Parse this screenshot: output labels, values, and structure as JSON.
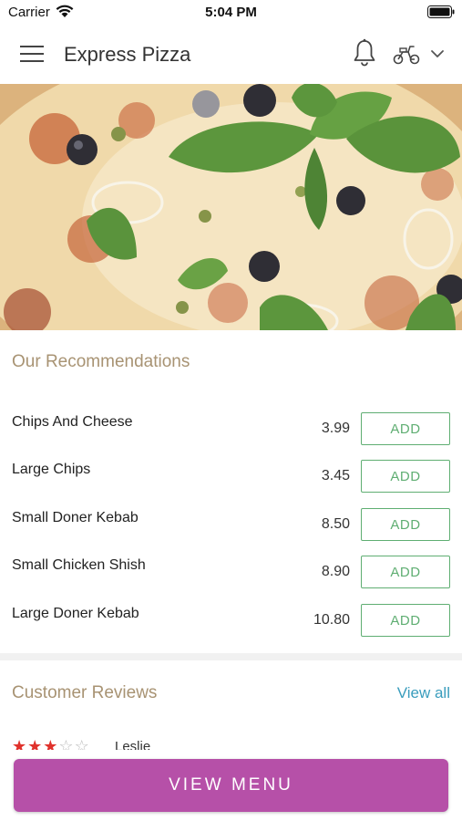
{
  "status_bar": {
    "carrier": "Carrier",
    "time": "5:04 PM"
  },
  "header": {
    "title": "Express Pizza",
    "icons": [
      "menu-icon",
      "bell-icon",
      "scooter-icon",
      "chevron-down-icon"
    ]
  },
  "recommendations": {
    "title": "Our Recommendations",
    "add_label": "ADD",
    "items": [
      {
        "name": "Chips And Cheese",
        "price": "3.99"
      },
      {
        "name": "Large Chips",
        "price": "3.45"
      },
      {
        "name": "Small Doner Kebab",
        "price": "8.50"
      },
      {
        "name": "Small Chicken Shish",
        "price": "8.90"
      },
      {
        "name": "Large Doner Kebab",
        "price": "10.80"
      }
    ]
  },
  "reviews": {
    "title": "Customer Reviews",
    "view_all": "View all",
    "first": {
      "reviewer": "Leslie",
      "rating": 3,
      "max_rating": 5
    }
  },
  "footer": {
    "view_menu": "VIEW MENU"
  },
  "colors": {
    "accent_purple": "#b650a8",
    "add_green": "#5fae72",
    "section_title": "#a89373",
    "link_blue": "#3a9dbd",
    "star_red": "#e0322c"
  }
}
